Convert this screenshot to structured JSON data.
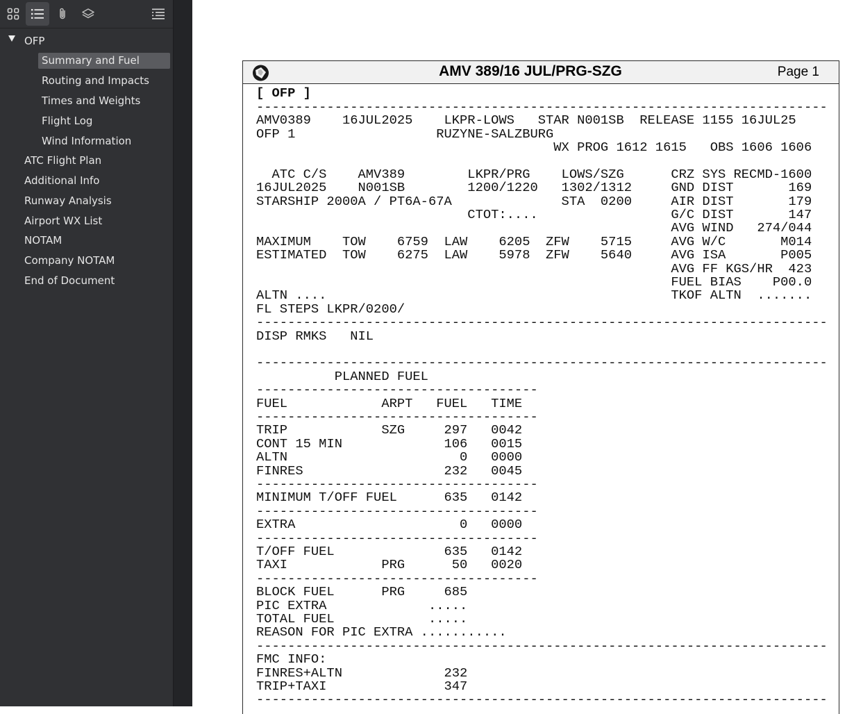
{
  "sidebar": {
    "toolbar": [
      "grid-view",
      "outline-view",
      "attachments",
      "layers",
      "filter-options"
    ],
    "tree": {
      "root": "OFP",
      "children": [
        "Summary and Fuel",
        "Routing and Impacts",
        "Times and Weights",
        "Flight Log",
        "Wind Information"
      ],
      "selected": "Summary and Fuel",
      "items": [
        "ATC Flight Plan",
        "Additional Info",
        "Runway Analysis",
        "Airport WX List",
        "NOTAM",
        "Company NOTAM",
        "End of Document"
      ]
    }
  },
  "document": {
    "title": "AMV 389/16 JUL/PRG-SZG",
    "page_label": "Page 1",
    "lines": [
      "[ OFP ]",
      "-------------------------------------------------------------------------",
      "AMV0389    16JUL2025    LKPR-LOWS   STAR N001SB  RELEASE 1155 16JUL25",
      "OFP 1                  RUZYNE-SALZBURG",
      "                                      WX PROG 1612 1615   OBS 1606 1606",
      "",
      "  ATC C/S    AMV389        LKPR/PRG    LOWS/SZG      CRZ SYS RECMD-1600",
      "16JUL2025    N001SB        1200/1220   1302/1312     GND DIST       169",
      "STARSHIP 2000A / PT6A-67A              STA  0200     AIR DIST       179",
      "                           CTOT:....                 G/C DIST       147",
      "                                                     AVG WIND   274/044",
      "MAXIMUM    TOW    6759  LAW    6205  ZFW    5715     AVG W/C       M014",
      "ESTIMATED  TOW    6275  LAW    5978  ZFW    5640     AVG ISA       P005",
      "                                                     AVG FF KGS/HR  423",
      "                                                     FUEL BIAS    P00.0",
      "ALTN ....                                            TKOF ALTN  .......",
      "FL STEPS LKPR/0200/",
      "-------------------------------------------------------------------------",
      "DISP RMKS   NIL",
      "",
      "-------------------------------------------------------------------------",
      "          PLANNED FUEL",
      "------------------------------------",
      "FUEL            ARPT   FUEL   TIME",
      "------------------------------------",
      "TRIP            SZG     297   0042",
      "CONT 15 MIN             106   0015",
      "ALTN                      0   0000",
      "FINRES                  232   0045",
      "------------------------------------",
      "MINIMUM T/OFF FUEL      635   0142",
      "------------------------------------",
      "EXTRA                     0   0000",
      "------------------------------------",
      "T/OFF FUEL              635   0142",
      "TAXI            PRG      50   0020",
      "------------------------------------",
      "BLOCK FUEL      PRG     685",
      "PIC EXTRA             .....",
      "TOTAL FUEL            .....",
      "REASON FOR PIC EXTRA ...........",
      "-------------------------------------------------------------------------",
      "FMC INFO:",
      "FINRES+ALTN             232",
      "TRIP+TAXI               347",
      "-------------------------------------------------------------------------"
    ]
  }
}
